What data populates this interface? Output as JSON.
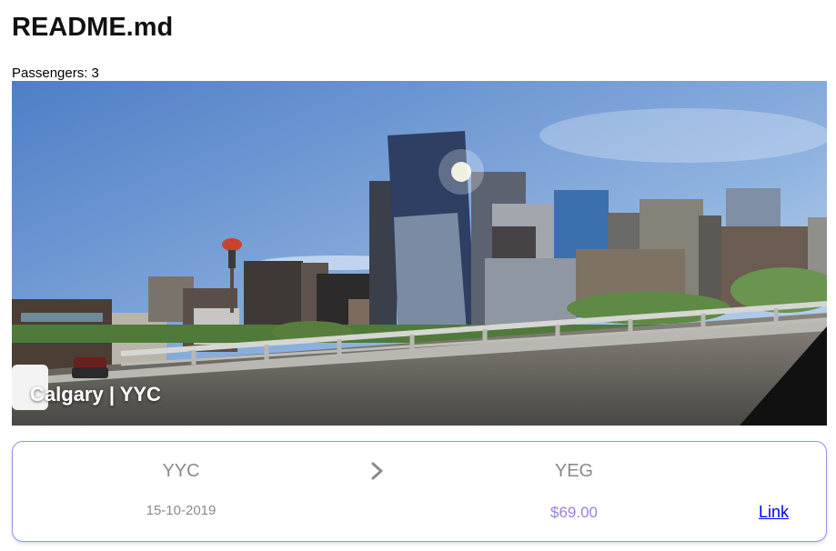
{
  "page": {
    "title": "README.md",
    "passengers_text": "Passengers: 3"
  },
  "hero": {
    "caption": "Calgary | YYC"
  },
  "flight": {
    "origin": "YYC",
    "destination": "YEG",
    "date": "15-10-2019",
    "price": "$69.00",
    "link_label": "Link"
  },
  "colors": {
    "card_border": "#8d96d9",
    "price": "#9b7fd8",
    "muted_text": "#8a8a8a",
    "link": "#0000ee"
  },
  "icons": {
    "route_arrow": "chevron-right-icon"
  }
}
